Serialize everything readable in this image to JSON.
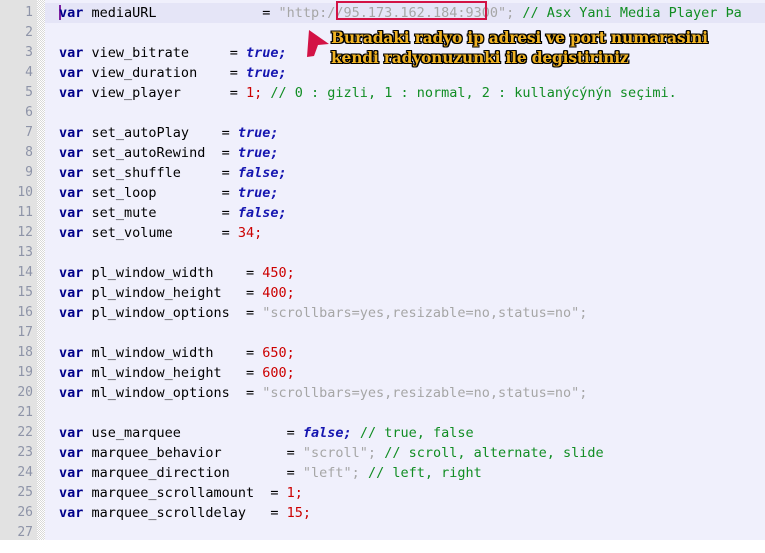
{
  "editor": {
    "total_lines": 27,
    "line_numbers": [
      1,
      2,
      3,
      4,
      5,
      6,
      7,
      8,
      9,
      10,
      11,
      12,
      13,
      14,
      15,
      16,
      17,
      18,
      19,
      20,
      21,
      22,
      23,
      24,
      25,
      26,
      27
    ],
    "highlighted_line": 1,
    "colors": {
      "gutter_background": "#e2e2e2",
      "line_number": "#8e94a8",
      "code_background": "#f0f0fc",
      "current_line_background": "#e5e5f7",
      "keyword": "#00008b",
      "boolean": "#1515b0",
      "number": "#cc0000",
      "string": "#a6a6a6",
      "comment": "#118d23",
      "caret": "#7b1fa2",
      "highlight_box": "#d31245",
      "arrow": "#d31245",
      "annotation_fill": "#f0b323",
      "annotation_outline": "#000000"
    }
  },
  "code": {
    "lines": [
      {
        "n": 1,
        "kw": "var",
        "name": "mediaURL",
        "pad": 12,
        "op": "=",
        "value": "\"http://95.173.162.184:9300\";",
        "value_type": "string",
        "comment": "// Asx Yani Media Player Þa"
      },
      {
        "n": 2,
        "blank": true
      },
      {
        "n": 3,
        "kw": "var",
        "name": "view_bitrate",
        "pad": 4,
        "op": "=",
        "value": "true;",
        "value_type": "bool",
        "comment": ""
      },
      {
        "n": 4,
        "kw": "var",
        "name": "view_duration",
        "pad": 3,
        "op": "=",
        "value": "true;",
        "value_type": "bool",
        "comment": ""
      },
      {
        "n": 5,
        "kw": "var",
        "name": "view_player",
        "pad": 5,
        "op": "=",
        "value": "1;",
        "value_type": "number",
        "comment": "// 0 : gizli, 1 : normal, 2 : kullanýcýnýn seçimi."
      },
      {
        "n": 6,
        "blank": true
      },
      {
        "n": 7,
        "kw": "var",
        "name": "set_autoPlay",
        "pad": 3,
        "op": "=",
        "value": "true;",
        "value_type": "bool",
        "comment": ""
      },
      {
        "n": 8,
        "kw": "var",
        "name": "set_autoRewind",
        "pad": 1,
        "op": "=",
        "value": "true;",
        "value_type": "bool",
        "comment": ""
      },
      {
        "n": 9,
        "kw": "var",
        "name": "set_shuffle",
        "pad": 4,
        "op": "=",
        "value": "false;",
        "value_type": "bool",
        "comment": ""
      },
      {
        "n": 10,
        "kw": "var",
        "name": "set_loop",
        "pad": 7,
        "op": "=",
        "value": "true;",
        "value_type": "bool",
        "comment": ""
      },
      {
        "n": 11,
        "kw": "var",
        "name": "set_mute",
        "pad": 7,
        "op": "=",
        "value": "false;",
        "value_type": "bool",
        "comment": ""
      },
      {
        "n": 12,
        "kw": "var",
        "name": "set_volume",
        "pad": 5,
        "op": "=",
        "value": "34;",
        "value_type": "number",
        "comment": ""
      },
      {
        "n": 13,
        "blank": true
      },
      {
        "n": 14,
        "kw": "var",
        "name": "pl_window_width",
        "pad": 3,
        "op": "=",
        "value": "450;",
        "value_type": "number",
        "comment": ""
      },
      {
        "n": 15,
        "kw": "var",
        "name": "pl_window_height",
        "pad": 2,
        "op": "=",
        "value": "400;",
        "value_type": "number",
        "comment": ""
      },
      {
        "n": 16,
        "kw": "var",
        "name": "pl_window_options",
        "pad": 1,
        "op": "=",
        "value": "\"scrollbars=yes,resizable=no,status=no\";",
        "value_type": "string",
        "comment": ""
      },
      {
        "n": 17,
        "blank": true
      },
      {
        "n": 18,
        "kw": "var",
        "name": "ml_window_width",
        "pad": 3,
        "op": "=",
        "value": "650;",
        "value_type": "number",
        "comment": ""
      },
      {
        "n": 19,
        "kw": "var",
        "name": "ml_window_height",
        "pad": 2,
        "op": "=",
        "value": "600;",
        "value_type": "number",
        "comment": ""
      },
      {
        "n": 20,
        "kw": "var",
        "name": "ml_window_options",
        "pad": 1,
        "op": "=",
        "value": "\"scrollbars=yes,resizable=no,status=no\";",
        "value_type": "string",
        "comment": ""
      },
      {
        "n": 21,
        "blank": true
      },
      {
        "n": 22,
        "kw": "var",
        "name": "use_marquee",
        "pad": 12,
        "op": "=",
        "value": "false;",
        "value_type": "bool",
        "comment": "// true, false"
      },
      {
        "n": 23,
        "kw": "var",
        "name": "marquee_behavior",
        "pad": 7,
        "op": "=",
        "value": "\"scroll\";",
        "value_type": "string",
        "comment": "// scroll, alternate, slide"
      },
      {
        "n": 24,
        "kw": "var",
        "name": "marquee_direction",
        "pad": 6,
        "op": "=",
        "value": "\"left\";",
        "value_type": "string",
        "comment": "// left, right"
      },
      {
        "n": 25,
        "kw": "var",
        "name": "marquee_scrollamount",
        "pad": 1,
        "op": "=",
        "value": "1;",
        "value_type": "number",
        "comment": ""
      },
      {
        "n": 26,
        "kw": "var",
        "name": "marquee_scrolldelay",
        "pad": 2,
        "op": "=",
        "value": "15;",
        "value_type": "number",
        "comment": ""
      },
      {
        "n": 27,
        "blank": true
      }
    ]
  },
  "highlight_box": {
    "label": "ip-port-highlight",
    "text": "95.173.162.184:9300"
  },
  "annotation": {
    "line1": "Buradaki radyo ip adresi ve port numarasini",
    "line2": "kendi radyonuzunki ile degistiriniz"
  }
}
